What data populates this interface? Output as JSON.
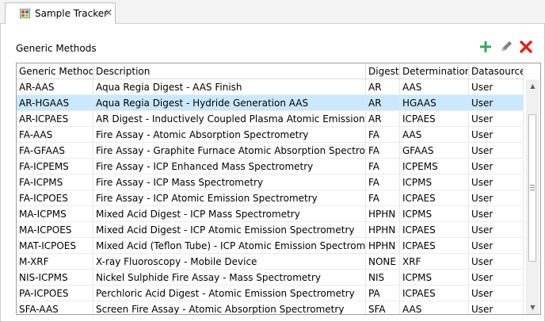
{
  "tab": {
    "title": "Sample Tracker",
    "close_glyph": "✕",
    "icon": "sample-tracker-icon"
  },
  "section": {
    "title": "Generic Methods"
  },
  "toolbar": {
    "add_icon": "plus-icon",
    "edit_icon": "pencil-icon",
    "delete_icon": "x-icon",
    "colors": {
      "add": "#3aa757",
      "edit": "#707070",
      "delete": "#d9261c"
    }
  },
  "table": {
    "columns": [
      "Generic Method",
      "Description",
      "Digest",
      "Determination",
      "Datasource"
    ],
    "selected_row": 1,
    "rows": [
      [
        "AR-AAS",
        "Aqua Regia Digest -  AAS Finish",
        "AR",
        "AAS",
        "User"
      ],
      [
        "AR-HGAAS",
        "Aqua Regia Digest - Hydride Generation AAS",
        "AR",
        "HGAAS",
        "User"
      ],
      [
        "AR-ICPAES",
        "AR Digest - Inductively Coupled Plasma Atomic Emission",
        "AR",
        "ICPAES",
        "User"
      ],
      [
        "FA-AAS",
        "Fire Assay - Atomic Absorption Spectrometry",
        "FA",
        "AAS",
        "User"
      ],
      [
        "FA-GFAAS",
        "Fire Assay - Graphite Furnace Atomic Absorption Spectrometry",
        "FA",
        "GFAAS",
        "User"
      ],
      [
        "FA-ICPEMS",
        "Fire Assay - ICP Enhanced Mass Spectrometry",
        "FA",
        "ICPEMS",
        "User"
      ],
      [
        "FA-ICPMS",
        "Fire Assay - ICP Mass Spectrometry",
        "FA",
        "ICPMS",
        "User"
      ],
      [
        "FA-ICPOES",
        "Fire Assay - ICP Atomic Emission Spectrometry",
        "FA",
        "ICPAES",
        "User"
      ],
      [
        "MA-ICPMS",
        "Mixed Acid Digest - ICP Mass Spectrometry",
        "HPHN",
        "ICPMS",
        "User"
      ],
      [
        "MA-ICPOES",
        "Mixed Acid Digest - ICP Atomic Emission Spectrometry",
        "HPHN",
        "ICPAES",
        "User"
      ],
      [
        "MAT-ICPOES",
        "Mixed Acid (Teflon Tube) - ICP Atomic Emission Spectrometry",
        "HPHN",
        "ICPAES",
        "User"
      ],
      [
        "M-XRF",
        "X-ray Fluoroscopy - Mobile Device",
        "NONE",
        "XRF",
        "User"
      ],
      [
        "NIS-ICPMS",
        "Nickel Sulphide Fire Assay - Mass Spectrometry",
        "NIS",
        "ICPMS",
        "User"
      ],
      [
        "PA-ICPOES",
        "Perchloric Acid Digest - Atomic Emission Spectrometry",
        "PA",
        "ICPAES",
        "User"
      ],
      [
        "SFA-AAS",
        "Screen Fire Assay - Atomic Absorption Spectrometry",
        "SFA",
        "AAS",
        "User"
      ]
    ]
  },
  "scrollbar": {
    "up_glyph": "▲",
    "down_glyph": "▼"
  }
}
